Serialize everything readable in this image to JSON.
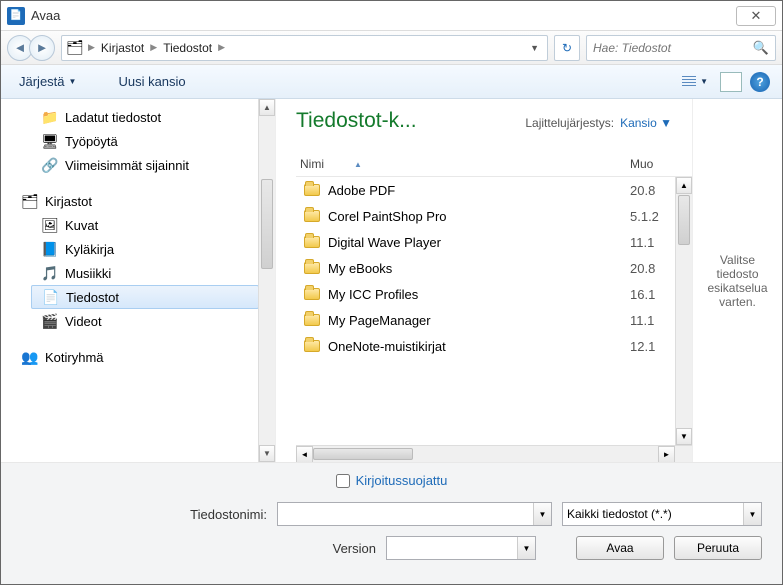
{
  "window": {
    "title": "Avaa",
    "close_label": "✕"
  },
  "nav": {
    "breadcrumb": [
      "Kirjastot",
      "Tiedostot"
    ],
    "search_placeholder": "Hae: Tiedostot"
  },
  "toolbar": {
    "organize": "Järjestä",
    "new_folder": "Uusi kansio",
    "help": "?"
  },
  "sidebar": {
    "recent": [
      {
        "label": "Ladatut tiedostot",
        "icon": "📁"
      },
      {
        "label": "Työpöytä",
        "icon": "🖥"
      },
      {
        "label": "Viimeisimmät sijainnit",
        "icon": "🔗"
      }
    ],
    "libraries_label": "Kirjastot",
    "libraries": [
      {
        "label": "Kuvat",
        "icon": "🖼"
      },
      {
        "label": "Kyläkirja",
        "icon": "📘"
      },
      {
        "label": "Musiikki",
        "icon": "🎵"
      },
      {
        "label": "Tiedostot",
        "icon": "📄",
        "selected": true
      },
      {
        "label": "Videot",
        "icon": "🎬"
      }
    ],
    "homegroup_label": "Kotiryhmä"
  },
  "content": {
    "library_title": "Tiedostot-k...",
    "arrange_label": "Lajittelujärjestys:",
    "arrange_value": "Kansio",
    "columns": {
      "name": "Nimi",
      "modified": "Muo"
    },
    "files": [
      {
        "name": "Adobe PDF",
        "modified": "20.8"
      },
      {
        "name": "Corel PaintShop Pro",
        "modified": "5.1.2"
      },
      {
        "name": "Digital Wave Player",
        "modified": "11.1"
      },
      {
        "name": "My eBooks",
        "modified": "20.8"
      },
      {
        "name": "My ICC Profiles",
        "modified": "16.1"
      },
      {
        "name": "My PageManager",
        "modified": "11.1"
      },
      {
        "name": "OneNote-muistikirjat",
        "modified": "12.1"
      }
    ],
    "preview_text": "Valitse tiedosto esikatselua varten."
  },
  "footer": {
    "readonly_label": "Kirjoitussuojattu",
    "filename_label": "Tiedostonimi:",
    "filename_value": "",
    "filter_value": "Kaikki tiedostot (*.*)",
    "version_label": "Version",
    "version_value": "",
    "open_btn": "Avaa",
    "cancel_btn": "Peruuta"
  }
}
